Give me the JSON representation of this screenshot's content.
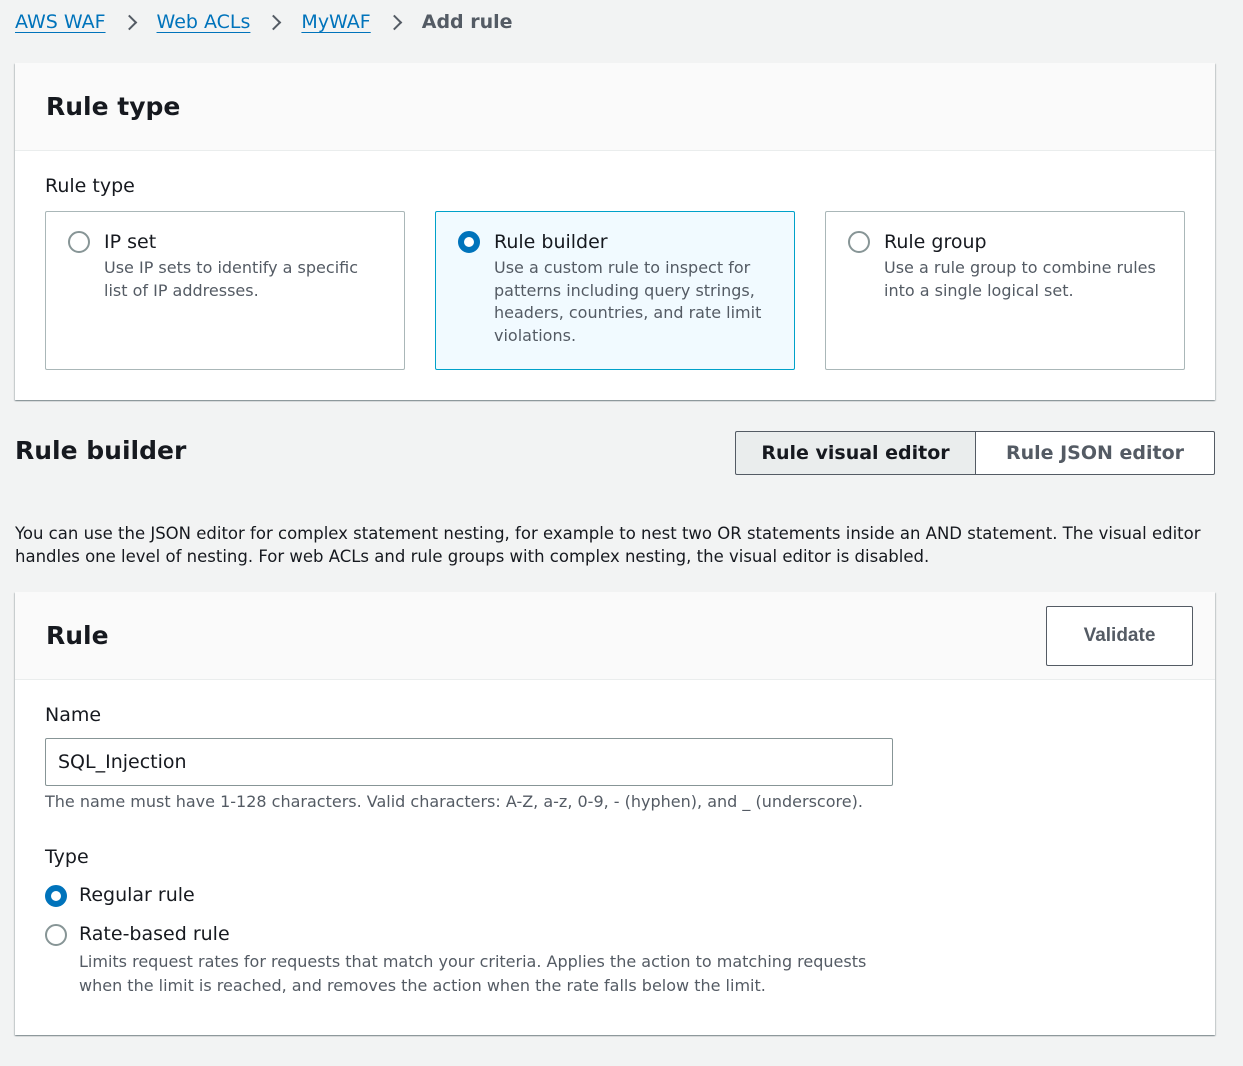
{
  "breadcrumb": {
    "items": [
      "AWS WAF",
      "Web ACLs",
      "MyWAF"
    ],
    "current": "Add rule"
  },
  "rule_type_panel": {
    "title": "Rule type",
    "field_label": "Rule type",
    "options": [
      {
        "title": "IP set",
        "description": "Use IP sets to identify a specific list of IP addresses.",
        "selected": false
      },
      {
        "title": "Rule builder",
        "description": "Use a custom rule to inspect for patterns including query strings, headers, countries, and rate limit violations.",
        "selected": true
      },
      {
        "title": "Rule group",
        "description": "Use a rule group to combine rules into a single logical set.",
        "selected": false
      }
    ]
  },
  "rule_builder": {
    "title": "Rule builder",
    "visual_editor_label": "Rule visual editor",
    "json_editor_label": "Rule JSON editor",
    "note": "You can use the JSON editor for complex statement nesting, for example to nest two OR statements inside an AND statement. The visual editor handles one level of nesting. For web ACLs and rule groups with complex nesting, the visual editor is disabled."
  },
  "rule_panel": {
    "title": "Rule",
    "validate_label": "Validate",
    "name_label": "Name",
    "name_value": "SQL_Injection",
    "name_hint": "The name must have 1-128 characters. Valid characters: A-Z, a-z, 0-9, - (hyphen), and _ (underscore).",
    "type_label": "Type",
    "type_options": [
      {
        "label": "Regular rule",
        "selected": true,
        "description": ""
      },
      {
        "label": "Rate-based rule",
        "selected": false,
        "description": "Limits request rates for requests that match your criteria. Applies the action to matching requests when the limit is reached, and removes the action when the rate falls below the limit."
      }
    ]
  },
  "colors": {
    "link": "#0073bb",
    "selected_tile_bg": "#f1faff",
    "selected_tile_border": "#00a1c9",
    "page_bg": "#f2f3f3"
  }
}
